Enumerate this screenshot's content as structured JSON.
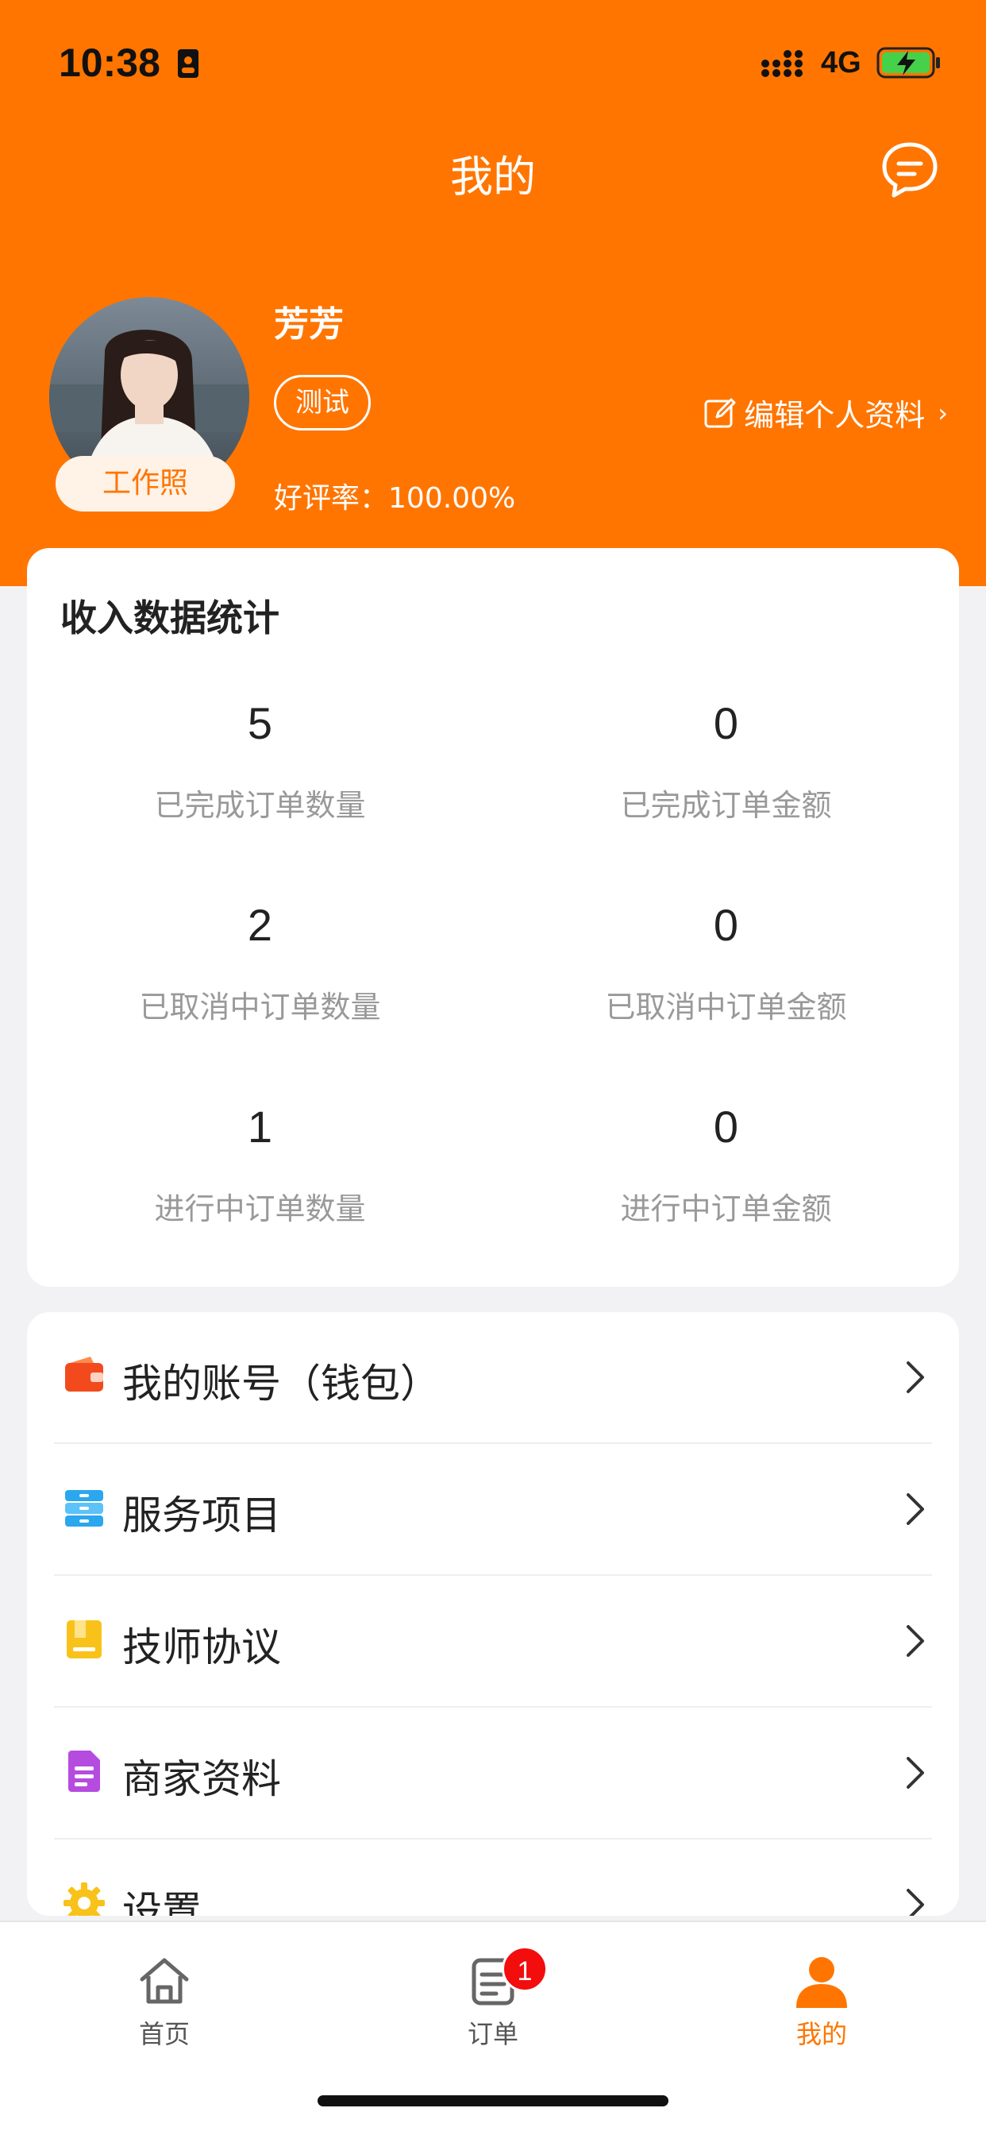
{
  "status_bar": {
    "time": "10:38",
    "network": "4G"
  },
  "header": {
    "title": "我的"
  },
  "profile": {
    "name": "芳芳",
    "tag": "测试",
    "rating_label": "好评率：",
    "rating_value": "100.00%",
    "work_photo_label": "工作照",
    "edit_label": "编辑个人资料",
    "edit_chevron": "›"
  },
  "stats": {
    "title": "收入数据统计",
    "items": [
      {
        "value": "5",
        "label": "已完成订单数量"
      },
      {
        "value": "0",
        "label": "已完成订单金额"
      },
      {
        "value": "2",
        "label": "已取消中订单数量"
      },
      {
        "value": "0",
        "label": "已取消中订单金额"
      },
      {
        "value": "1",
        "label": "进行中订单数量"
      },
      {
        "value": "0",
        "label": "进行中订单金额"
      }
    ]
  },
  "menu": {
    "items": [
      {
        "label": "我的账号（钱包）",
        "icon": "wallet-icon",
        "color": "#f24a1d"
      },
      {
        "label": "服务项目",
        "icon": "service-list-icon",
        "color": "#2aa7ee"
      },
      {
        "label": "技师协议",
        "icon": "agreement-icon",
        "color": "#f8c21a"
      },
      {
        "label": "商家资料",
        "icon": "document-icon",
        "color": "#b64be0"
      },
      {
        "label": "设置",
        "icon": "settings-gear-icon",
        "color": "#f8c21a"
      }
    ]
  },
  "tabbar": {
    "items": [
      {
        "label": "首页",
        "icon": "home-icon"
      },
      {
        "label": "订单",
        "icon": "orders-icon",
        "badge": "1"
      },
      {
        "label": "我的",
        "icon": "profile-icon",
        "active": true
      }
    ]
  },
  "colors": {
    "brand": "#ff7500",
    "badge": "#f30d0d"
  }
}
